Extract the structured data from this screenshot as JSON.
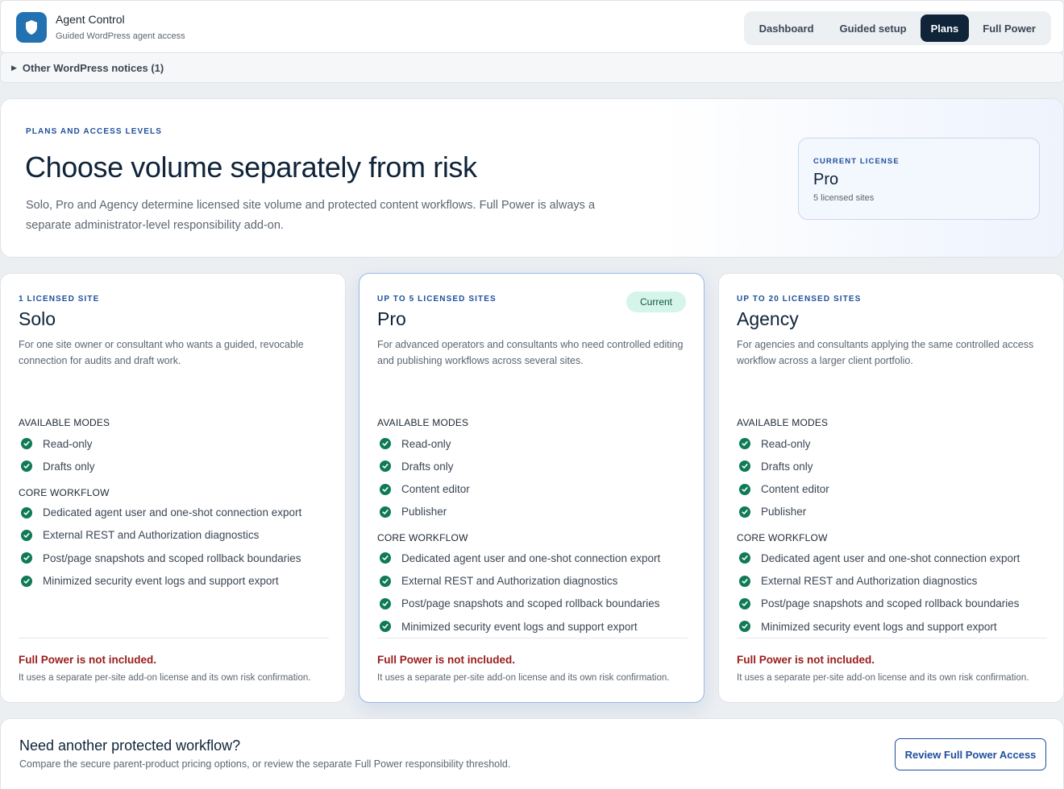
{
  "header": {
    "app_title": "Agent Control",
    "app_subtitle": "Guided WordPress agent access",
    "logo_icon": "shield-icon",
    "accent_color": "#2271b1",
    "nav": [
      {
        "label": "Dashboard",
        "active": false
      },
      {
        "label": "Guided setup",
        "active": false
      },
      {
        "label": "Plans",
        "active": true
      },
      {
        "label": "Full Power",
        "active": false
      }
    ]
  },
  "notices": {
    "label": "Other WordPress notices (1)"
  },
  "hero": {
    "eyebrow": "PLANS AND ACCESS LEVELS",
    "title": "Choose volume separately from risk",
    "description": "Solo, Pro and Agency determine licensed site volume and protected content workflows. Full Power is always a separate administrator-level responsibility add-on.",
    "license": {
      "eyebrow": "CURRENT LICENSE",
      "name": "Pro",
      "sites": "5 licensed sites"
    }
  },
  "plans": [
    {
      "eyebrow": "1 LICENSED SITE",
      "name": "Solo",
      "description": "For one site owner or consultant who wants a guided, revocable connection for audits and draft work.",
      "badge": "",
      "modes_label": "AVAILABLE MODES",
      "modes": [
        "Read-only",
        "Drafts only"
      ],
      "workflow_label": "CORE WORKFLOW",
      "workflow": [
        "Dedicated agent user and one-shot connection export",
        "External REST and Authorization diagnostics",
        "Post/page snapshots and scoped rollback boundaries",
        "Minimized security event logs and support export"
      ],
      "warning_title": "Full Power is not included.",
      "warning_desc": "It uses a separate per-site add-on license and its own risk confirmation."
    },
    {
      "eyebrow": "UP TO 5 LICENSED SITES",
      "name": "Pro",
      "description": "For advanced operators and consultants who need controlled editing and publishing workflows across several sites.",
      "badge": "Current",
      "modes_label": "AVAILABLE MODES",
      "modes": [
        "Read-only",
        "Drafts only",
        "Content editor",
        "Publisher"
      ],
      "workflow_label": "CORE WORKFLOW",
      "workflow": [
        "Dedicated agent user and one-shot connection export",
        "External REST and Authorization diagnostics",
        "Post/page snapshots and scoped rollback boundaries",
        "Minimized security event logs and support export"
      ],
      "warning_title": "Full Power is not included.",
      "warning_desc": "It uses a separate per-site add-on license and its own risk confirmation."
    },
    {
      "eyebrow": "UP TO 20 LICENSED SITES",
      "name": "Agency",
      "description": "For agencies and consultants applying the same controlled access workflow across a larger client portfolio.",
      "badge": "",
      "modes_label": "AVAILABLE MODES",
      "modes": [
        "Read-only",
        "Drafts only",
        "Content editor",
        "Publisher"
      ],
      "workflow_label": "CORE WORKFLOW",
      "workflow": [
        "Dedicated agent user and one-shot connection export",
        "External REST and Authorization diagnostics",
        "Post/page snapshots and scoped rollback boundaries",
        "Minimized security event logs and support export"
      ],
      "warning_title": "Full Power is not included.",
      "warning_desc": "It uses a separate per-site add-on license and its own risk confirmation."
    }
  ],
  "footer": {
    "title": "Need another protected workflow?",
    "description": "Compare the secure parent-product pricing options, or review the separate Full Power responsibility threshold.",
    "button_label": "Review Full Power Access"
  },
  "colors": {
    "check": "#0f7a57",
    "warning": "#9a1c1c",
    "eyebrow": "#1e4f9c",
    "nav_active": "#0f2339"
  }
}
